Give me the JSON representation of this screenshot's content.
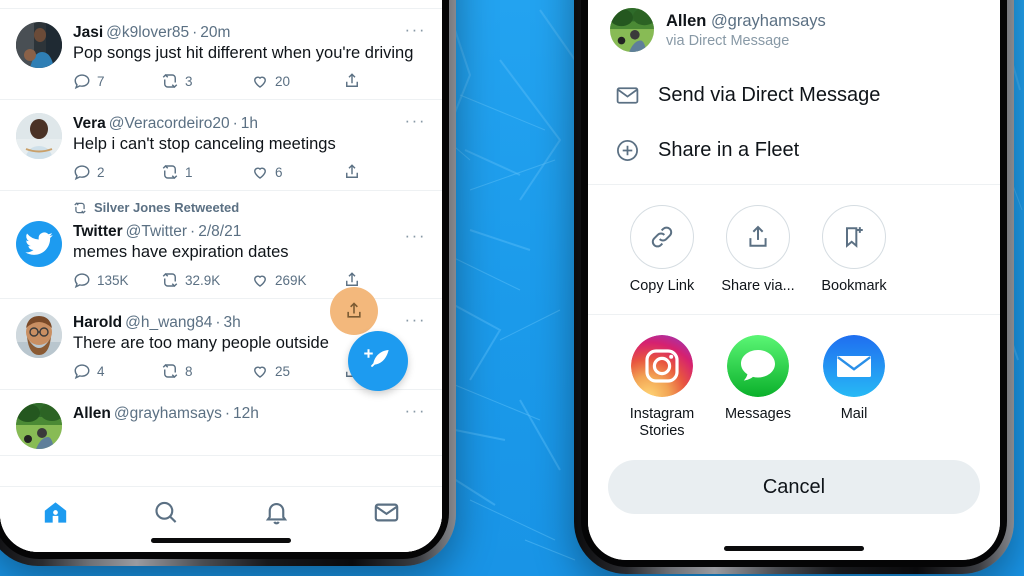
{
  "background": {
    "color": "#1E9FEF"
  },
  "left_phone": {
    "app": "Twitter",
    "timeline": [
      {
        "name": "Jasi",
        "handle": "@k9lover85",
        "time": "20m",
        "separator": "·",
        "text": "Pop songs just hit different when you're driving",
        "replies": "7",
        "retweets": "3",
        "likes": "20",
        "more": "···"
      },
      {
        "name": "Vera",
        "handle": "@Veracordeiro20",
        "time": "1h",
        "separator": "·",
        "text": "Help i can't stop canceling meetings",
        "replies": "2",
        "retweets": "1",
        "likes": "6",
        "more": "···"
      },
      {
        "retweeted_by": "Silver Jones Retweeted",
        "name": "Twitter",
        "handle": "@Twitter",
        "time": "2/8/21",
        "separator": "·",
        "text": "memes have expiration dates",
        "replies": "135K",
        "retweets": "32.9K",
        "likes": "269K",
        "more": "···"
      },
      {
        "name": "Harold",
        "handle": "@h_wang84",
        "time": "3h",
        "separator": "·",
        "text": "There are too many people outside",
        "replies": "4",
        "retweets": "8",
        "likes": "25",
        "more": "···"
      },
      {
        "name": "Allen",
        "handle": "@grayhamsays",
        "time": "12h",
        "separator": "·",
        "text": "",
        "more": "···"
      }
    ],
    "nav": [
      {
        "name": "home",
        "active": true
      },
      {
        "name": "search",
        "active": false
      },
      {
        "name": "notifications",
        "active": false
      },
      {
        "name": "messages",
        "active": false
      }
    ],
    "highlight": {
      "icon": "share-icon",
      "color": "#f3b87c"
    },
    "compose": {
      "icon": "compose-feather-icon",
      "color": "#1d9bf0"
    }
  },
  "right_phone": {
    "sheet": {
      "user": {
        "name": "Allen",
        "handle": "@grayhamsays",
        "subtitle": "via Direct Message"
      },
      "rows": [
        {
          "icon": "envelope-icon",
          "label": "Send via Direct Message"
        },
        {
          "icon": "plus-circle-icon",
          "label": "Share in a Fleet"
        }
      ],
      "circle_actions": [
        {
          "icon": "link-icon",
          "label": "Copy Link"
        },
        {
          "icon": "share-up-icon",
          "label": "Share via..."
        },
        {
          "icon": "bookmark-plus-icon",
          "label": "Bookmark"
        }
      ],
      "apps": [
        {
          "icon": "instagram-icon",
          "label": "Instagram Stories"
        },
        {
          "icon": "messages-icon",
          "label": "Messages"
        },
        {
          "icon": "mail-icon",
          "label": "Mail"
        }
      ],
      "cancel_label": "Cancel"
    }
  },
  "colors": {
    "twitter_blue": "#1d9bf0",
    "text_primary": "#0f1419",
    "text_secondary": "#5b7083",
    "highlight_orange": "#f3b87c",
    "cancel_bg": "#e9eef1"
  }
}
